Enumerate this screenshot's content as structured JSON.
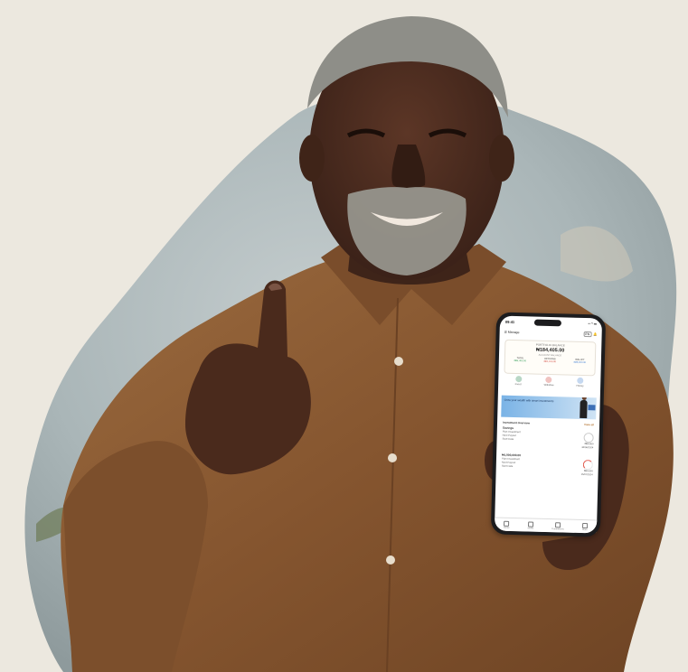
{
  "colors": {
    "background": "#ece8df",
    "blob": "#b3bdc0",
    "shirt": "#8a5a32",
    "skin": "#4a2b1e",
    "hair": "#8e8e88"
  },
  "phone": {
    "status_time": "09:41",
    "status_icons": "▪▪ ◠ ▬",
    "menu_label": "Manage",
    "lang_label": "EN",
    "balance": {
      "label": "PORTFOLIO BALANCE",
      "amount": "₦184,405.00",
      "sub": "ACCOUNT BALANCE",
      "values": [
        {
          "label": "TOTAL",
          "value": "₦84,405.00",
          "color": "#2f9b55"
        },
        {
          "label": "RETURNS",
          "value": "₦61,100.00",
          "color": "#d1483e"
        },
        {
          "label": "WALLET",
          "value": "₦38,900.00",
          "color": "#3b7bd1"
        }
      ]
    },
    "actions": [
      {
        "label": "Invest",
        "color": "#b9d7c6"
      },
      {
        "label": "Withdraw",
        "color": "#f0c3c0"
      },
      {
        "label": "History",
        "color": "#c5d8f0"
      }
    ],
    "banner_text": "Grow your wealth with smart investments",
    "section_title": "Investment Overview",
    "section_link": "View all",
    "items": [
      {
        "title": "Savings",
        "lines": [
          "Plan Investment",
          "Next Payout",
          "Start Date"
        ],
        "right": [
          "₦80,000",
          "30/06/2024"
        ]
      },
      {
        "title": "₦1,000,000.00",
        "lines": [
          "Plan Investment",
          "Next Payout",
          "Start Date"
        ],
        "right": [
          "₦50,000",
          "15/07/2024"
        ]
      }
    ],
    "tabs": [
      "Home",
      "Invest",
      "Transactions",
      "More"
    ]
  }
}
